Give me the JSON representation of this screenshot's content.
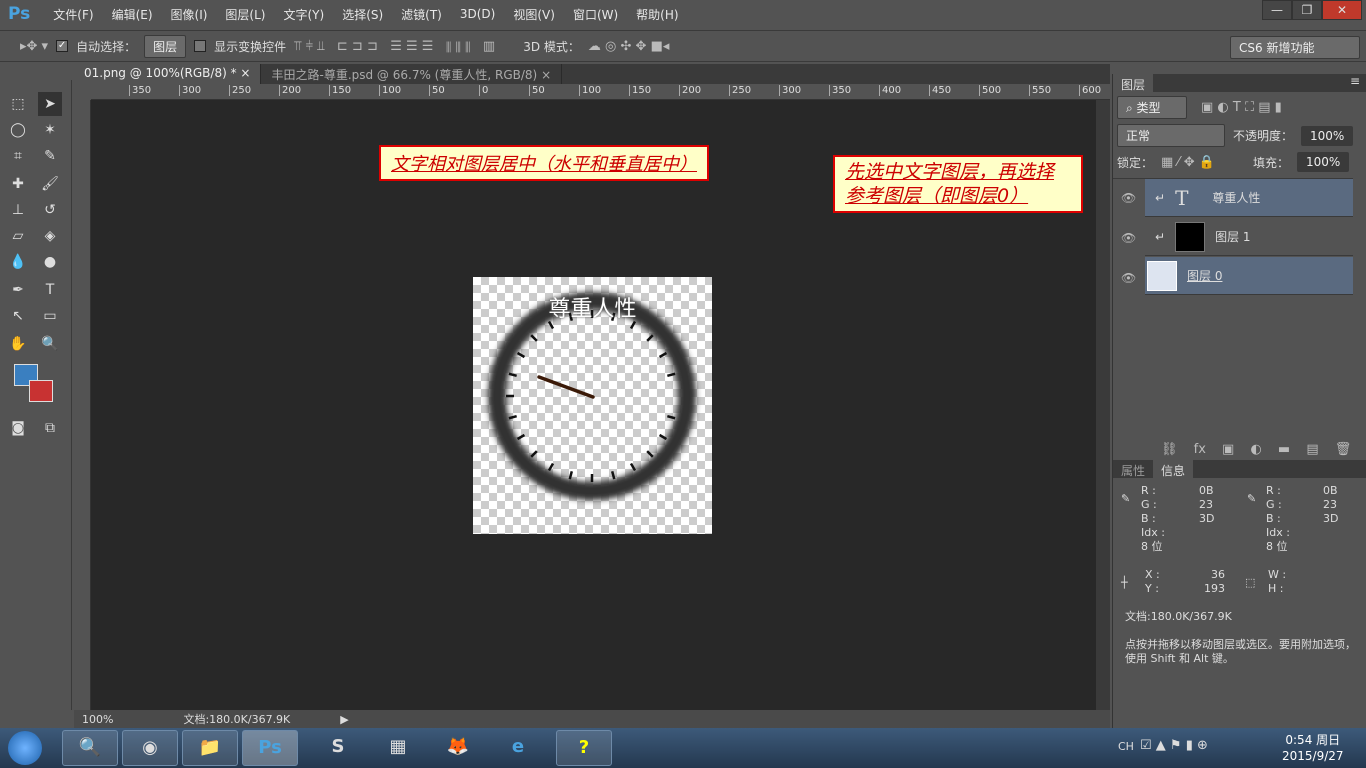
{
  "app": {
    "logo": "Ps",
    "menu": [
      "文件(F)",
      "编辑(E)",
      "图像(I)",
      "图层(L)",
      "文字(Y)",
      "选择(S)",
      "滤镜(T)",
      "3D(D)",
      "视图(V)",
      "窗口(W)",
      "帮助(H)"
    ]
  },
  "options": {
    "auto_select_label": "自动选择：",
    "auto_select_checked": true,
    "auto_select_target": "图层",
    "show_transform_label": "显示变换控件",
    "show_transform_checked": false,
    "mode_3d_label": "3D 模式：",
    "workspace": "CS6 新增功能"
  },
  "tabs": [
    {
      "label": "01.png @ 100%(RGB/8) *",
      "active": true
    },
    {
      "label": "丰田之路-尊重.psd @ 66.7% (尊重人性, RGB/8)",
      "active": false
    }
  ],
  "ruler": {
    "top_ticks": [
      "350",
      "300",
      "250",
      "200",
      "150",
      "100",
      "50",
      "0",
      "50",
      "100",
      "150",
      "200",
      "250",
      "300",
      "350",
      "400",
      "450",
      "500",
      "550",
      "600"
    ]
  },
  "canvas": {
    "note1": "文字相对图层居中（水平和垂直居中）",
    "note2": "先选中文字图层，再选择参考图层（即图层0）",
    "doc_text": "尊重人性"
  },
  "status": {
    "zoom": "100%",
    "doc": "文档:180.0K/367.9K"
  },
  "colors": {
    "foreground": "#3a7fc0",
    "background": "#c83232",
    "selected_layer": "#5a6a80"
  },
  "layers_panel": {
    "title": "图层",
    "filter": "类型",
    "blend": "正常",
    "opacity_label": "不透明度：",
    "opacity": "100%",
    "lock_label": "锁定：",
    "fill_label": "填充：",
    "fill": "100%",
    "layers": [
      {
        "name": "尊重人性",
        "type": "text",
        "selected": true
      },
      {
        "name": "图层 1",
        "type": "fill",
        "selected": false
      },
      {
        "name": "图层 0",
        "type": "image",
        "selected": true
      }
    ]
  },
  "info_panel": {
    "tabs": [
      "属性",
      "信息"
    ],
    "r_label": "R :",
    "g_label": "G :",
    "b_label": "B :",
    "idx_label": "Idx :",
    "bits": "8 位",
    "left": {
      "r": "0B",
      "g": "23",
      "b": "3D"
    },
    "right": {
      "r": "0B",
      "g": "23",
      "b": "3D"
    },
    "x_label": "X :",
    "y_label": "Y :",
    "x": "36",
    "y": "193",
    "w_label": "W :",
    "h_label": "H :",
    "doc": "文档:180.0K/367.9K",
    "hint": "点按并拖移以移动图层或选区。要用附加选项，使用 Shift 和 Alt 键。"
  },
  "taskbar": {
    "lang": "CH",
    "time": "0:54 周日",
    "date": "2015/9/27"
  }
}
